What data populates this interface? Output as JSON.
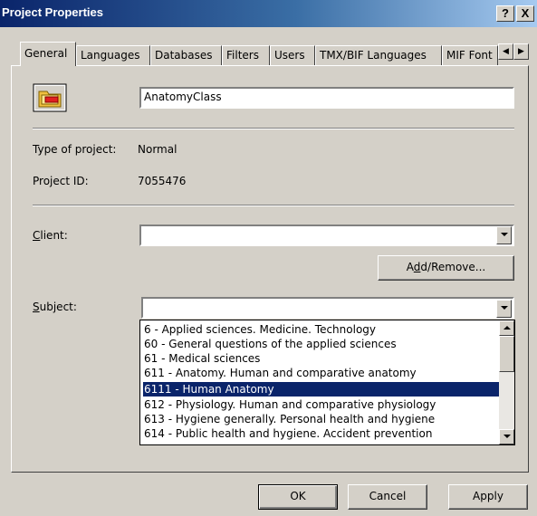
{
  "window": {
    "title": "Project Properties",
    "help_label": "?",
    "close_label": "X"
  },
  "tabs": [
    {
      "label": "General"
    },
    {
      "label": "Languages"
    },
    {
      "label": "Databases"
    },
    {
      "label": "Filters"
    },
    {
      "label": "Users"
    },
    {
      "label": "TMX/BIF Languages"
    },
    {
      "label": "MIF Font"
    }
  ],
  "general": {
    "project_name": "AnatomyClass",
    "type_label": "Type of project:",
    "type_value": "Normal",
    "id_label": "Project ID:",
    "id_value": "7055476",
    "client_label_pre": "",
    "client_label_mn": "C",
    "client_label_post": "lient:",
    "client_value": "",
    "add_remove_pre": "A",
    "add_remove_mn": "d",
    "add_remove_post": "d/Remove...",
    "subject_label_pre": "",
    "subject_label_mn": "S",
    "subject_label_post": "ubject:",
    "subject_value": "",
    "subject_options": [
      {
        "label": "6 - Applied sciences. Medicine. Technology",
        "selected": false
      },
      {
        "label": "60 - General questions of the applied sciences",
        "selected": false
      },
      {
        "label": "61 - Medical sciences",
        "selected": false
      },
      {
        "label": "611 - Anatomy. Human and comparative anatomy",
        "selected": false
      },
      {
        "label": "6111 - Human Anatomy",
        "selected": true
      },
      {
        "label": "612 - Physiology. Human and comparative physiology",
        "selected": false
      },
      {
        "label": "613 - Hygiene generally. Personal health and hygiene",
        "selected": false
      },
      {
        "label": "614 - Public health and hygiene. Accident prevention",
        "selected": false
      }
    ]
  },
  "buttons": {
    "ok": "OK",
    "cancel": "Cancel",
    "apply": "Apply"
  },
  "colors": {
    "title_bar": "#0a246a",
    "face": "#d4d0c8",
    "selection": "#0a246a"
  },
  "icons": {
    "project": "project-folder-icon"
  }
}
